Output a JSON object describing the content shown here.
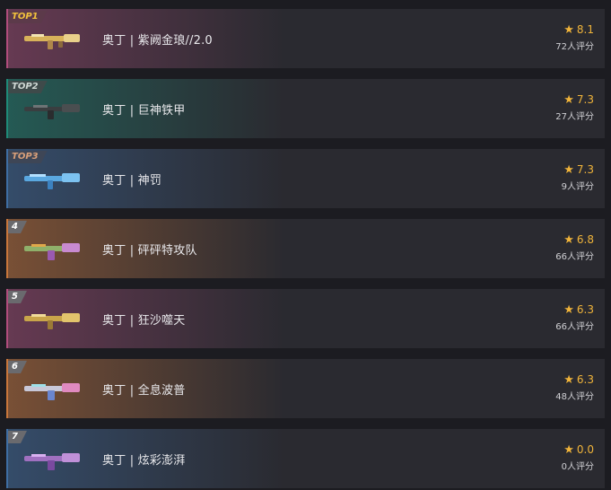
{
  "colors": {
    "background": "#1c1c21",
    "row": "#2a2a30",
    "star": "#f0b43a",
    "pink": "#b04d7c",
    "teal": "#1f8a78",
    "blue": "#3f6ea3",
    "orange": "#c8763b"
  },
  "items": [
    {
      "rank": "TOP1",
      "name": "奥丁 | 紫阙金琅//2.0",
      "score": "8.1",
      "count": "72人评分",
      "tint": "pink",
      "icon": "gold-rifle-icon"
    },
    {
      "rank": "TOP2",
      "name": "奥丁 | 巨神铁甲",
      "score": "7.3",
      "count": "27人评分",
      "tint": "teal",
      "icon": "dark-rifle-icon"
    },
    {
      "rank": "TOP3",
      "name": "奥丁 | 神罚",
      "score": "7.3",
      "count": "9人评分",
      "tint": "blue",
      "icon": "blue-rifle-icon"
    },
    {
      "rank": "4",
      "name": "奥丁 | 砰砰特攻队",
      "score": "6.8",
      "count": "66人评分",
      "tint": "orange",
      "icon": "colorful-rifle-icon"
    },
    {
      "rank": "5",
      "name": "奥丁 | 狂沙噬天",
      "score": "6.3",
      "count": "66人评分",
      "tint": "pink",
      "icon": "gold-rifle-icon"
    },
    {
      "rank": "6",
      "name": "奥丁 | 全息波普",
      "score": "6.3",
      "count": "48人评分",
      "tint": "orange",
      "icon": "holo-rifle-icon"
    },
    {
      "rank": "7",
      "name": "奥丁 | 炫彩澎湃",
      "score": "0.0",
      "count": "0人评分",
      "tint": "blue",
      "icon": "purple-rifle-icon"
    }
  ]
}
